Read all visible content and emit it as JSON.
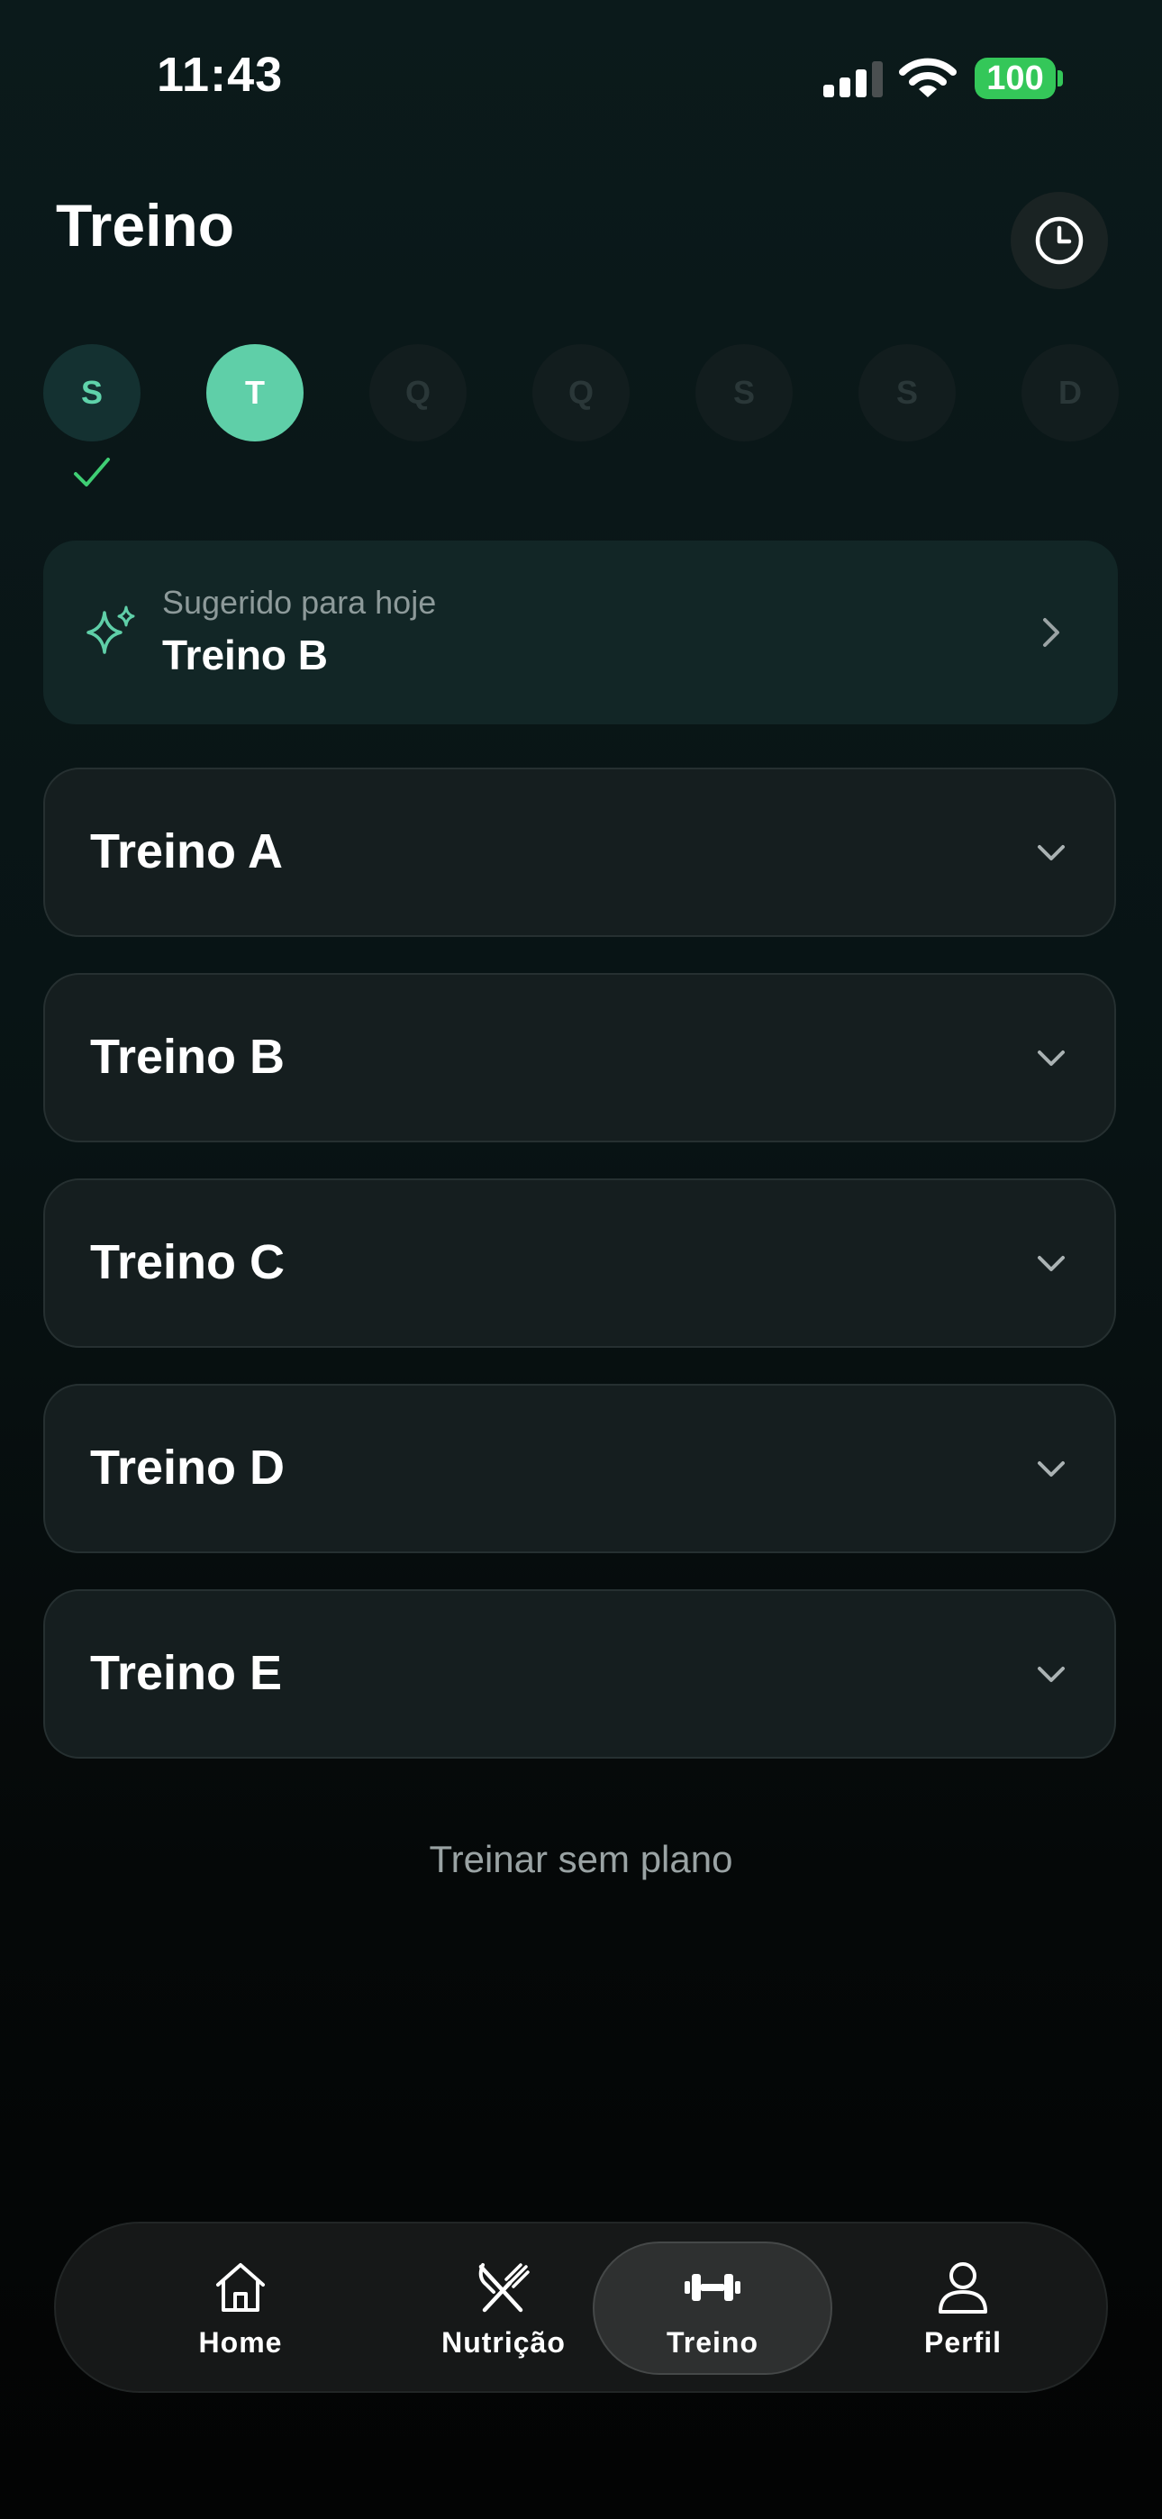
{
  "status_bar": {
    "time": "11:43",
    "battery": "100",
    "battery_color": "#34c759",
    "icons": [
      "signal-icon",
      "wifi-icon",
      "battery-icon"
    ]
  },
  "header": {
    "title": "Treino",
    "history_icon": "clock-icon"
  },
  "week": {
    "days": [
      {
        "label": "S",
        "state": "done"
      },
      {
        "label": "T",
        "state": "today"
      },
      {
        "label": "Q",
        "state": "future"
      },
      {
        "label": "Q",
        "state": "future"
      },
      {
        "label": "S",
        "state": "future"
      },
      {
        "label": "S",
        "state": "future"
      },
      {
        "label": "D",
        "state": "future"
      }
    ],
    "check_icon": "checkmark-icon"
  },
  "suggested": {
    "caption": "Sugerido para hoje",
    "title": "Treino B",
    "icon": "sparkles-icon"
  },
  "workouts": [
    {
      "title": "Treino A"
    },
    {
      "title": "Treino B"
    },
    {
      "title": "Treino C"
    },
    {
      "title": "Treino D"
    },
    {
      "title": "Treino E"
    }
  ],
  "train_without_plan": "Treinar sem plano",
  "tab_bar": {
    "active": "Treino",
    "tabs": [
      {
        "label": "Home",
        "icon": "home-icon"
      },
      {
        "label": "Nutrição",
        "icon": "utensils-icon"
      },
      {
        "label": "Treino",
        "icon": "dumbbell-icon"
      },
      {
        "label": "Perfil",
        "icon": "person-icon"
      }
    ]
  },
  "colors": {
    "accent": "#5fcfa8",
    "card": "#151e1f",
    "suggested_card": "#122626"
  }
}
